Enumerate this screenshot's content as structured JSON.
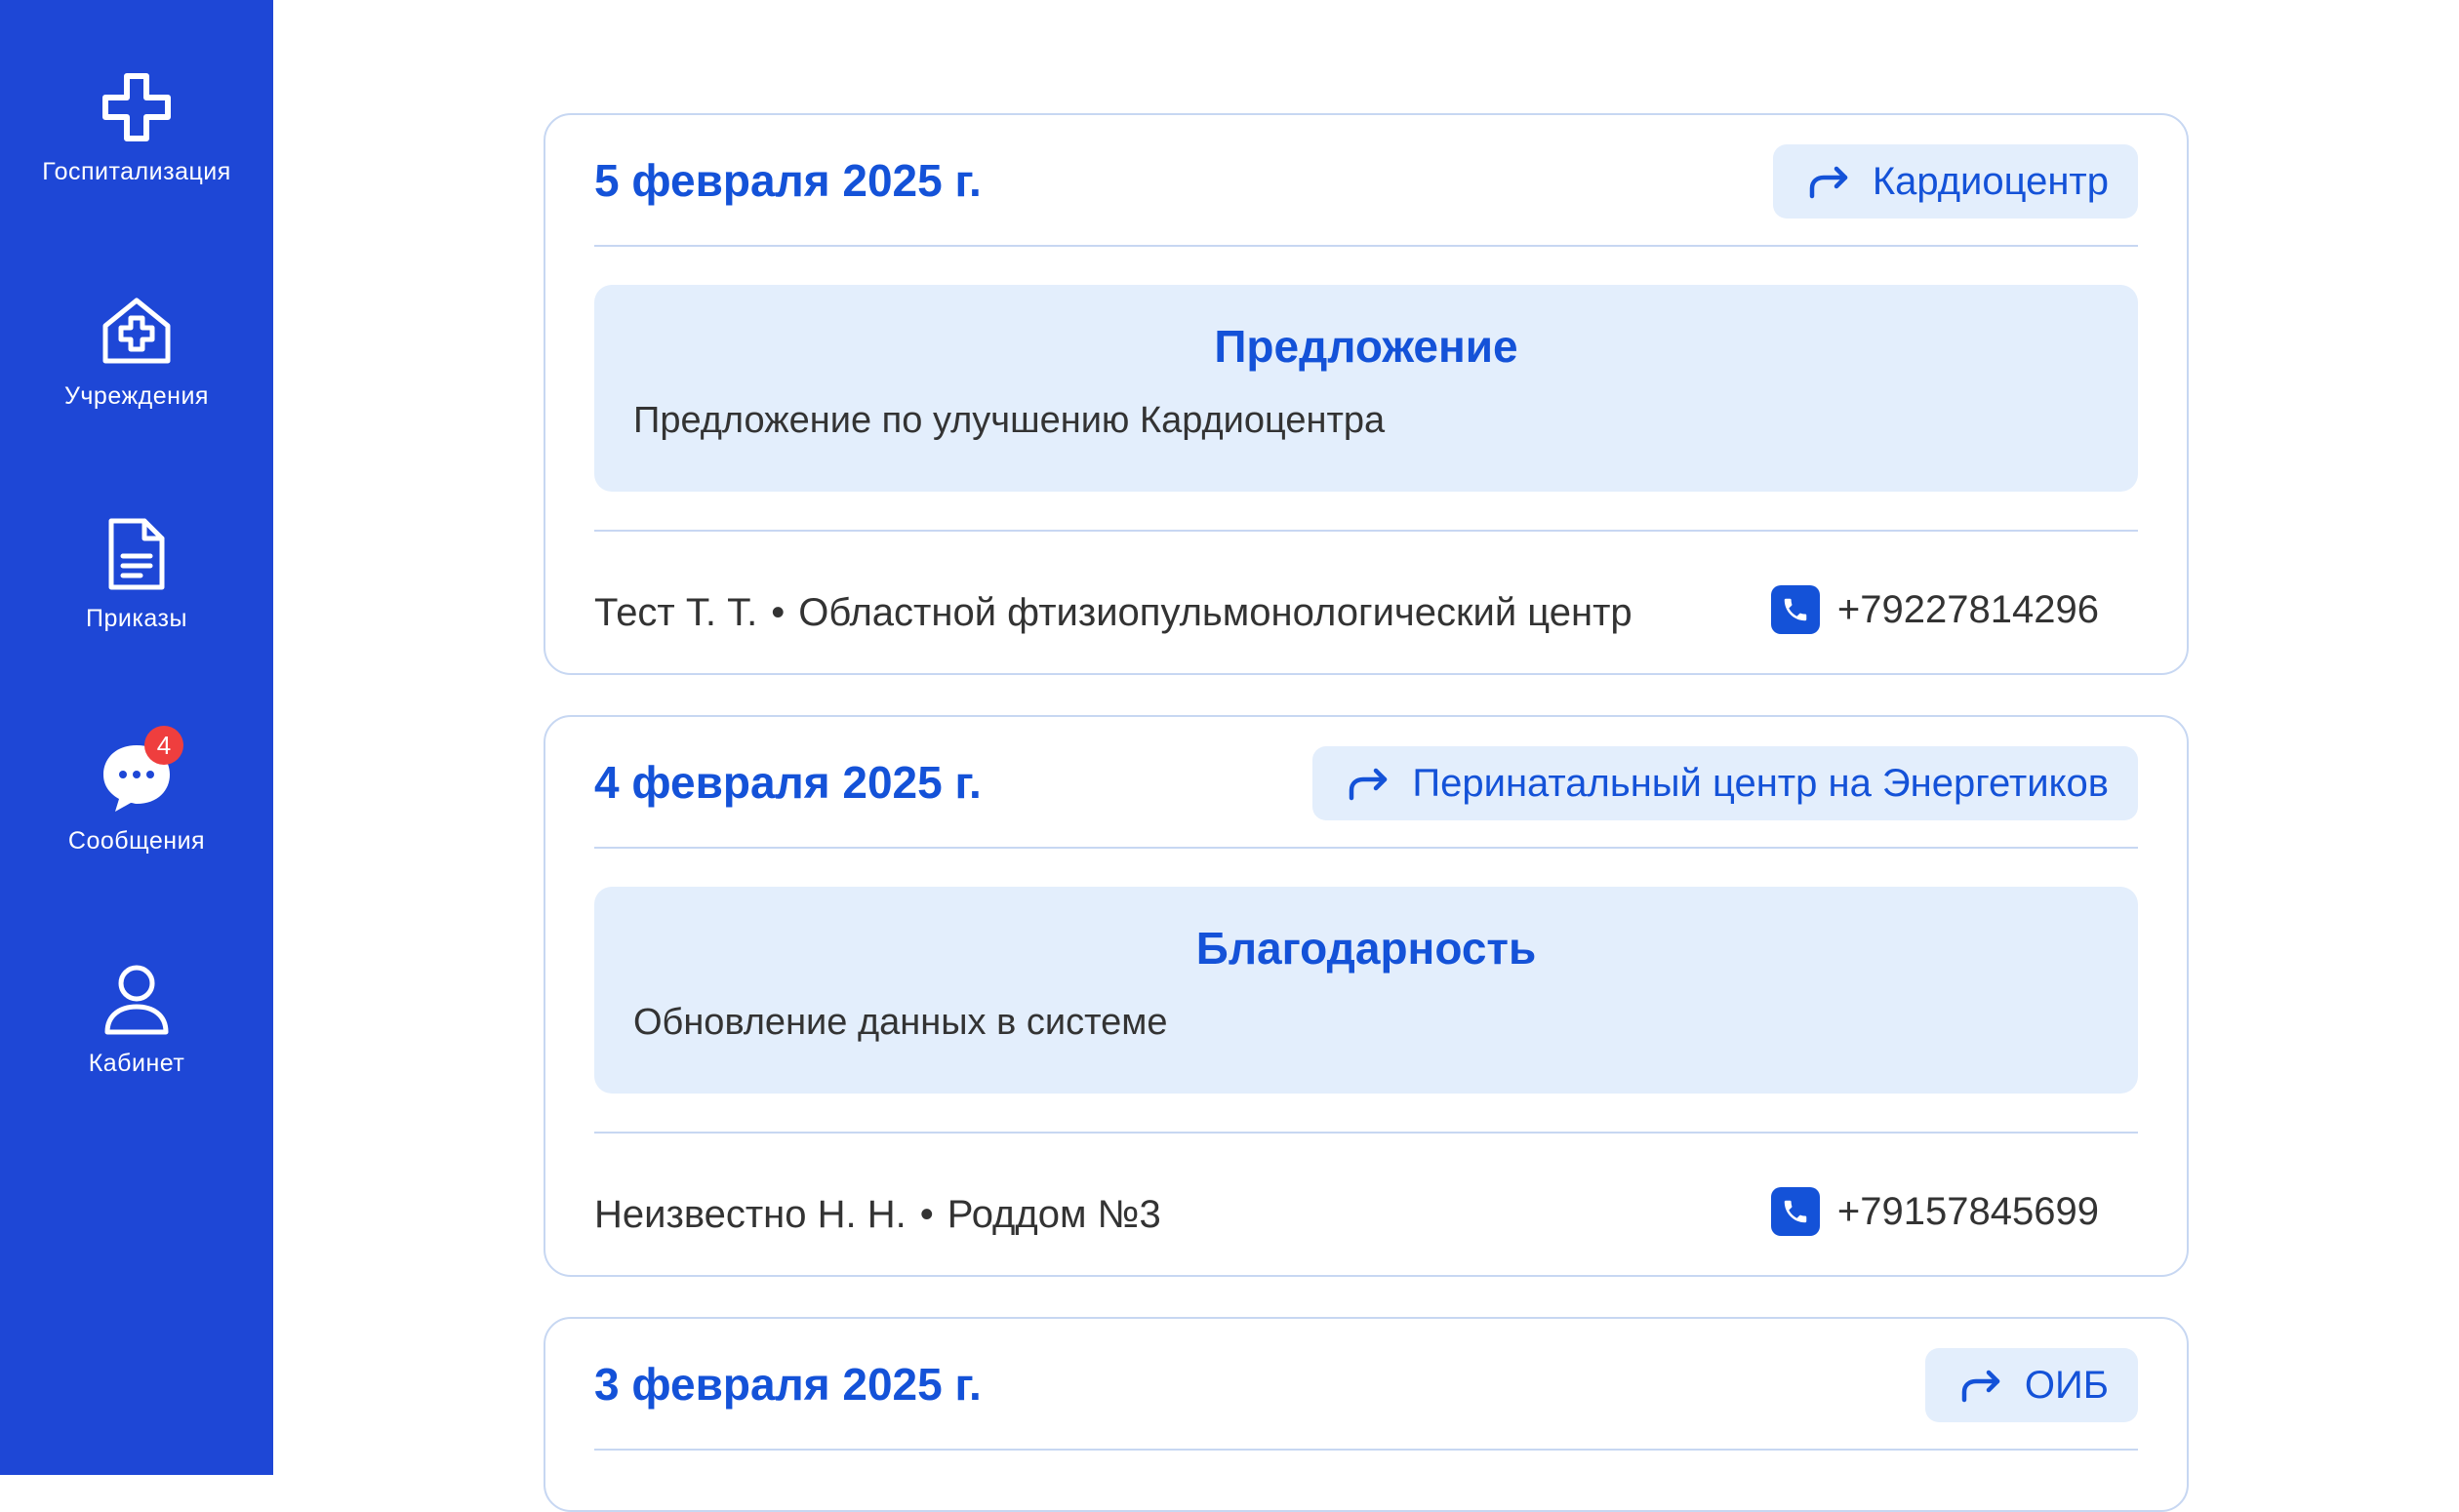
{
  "sidebar": {
    "items": [
      {
        "label": "Госпитализация",
        "icon": "medical-cross-icon"
      },
      {
        "label": "Учреждения",
        "icon": "hospital-house-icon"
      },
      {
        "label": "Приказы",
        "icon": "document-icon"
      },
      {
        "label": "Сообщения",
        "icon": "chat-bubble-icon",
        "badge": "4"
      },
      {
        "label": "Кабинет",
        "icon": "user-icon"
      }
    ]
  },
  "colors": {
    "sidebar_bg": "#1e47d6",
    "accent": "#1452d8",
    "chip_bg": "#e3eefc",
    "border": "#c7d7f2",
    "badge": "#ef3e3e"
  },
  "messages": [
    {
      "date": "5 февраля 2025 г.",
      "destination": "Кардиоцентр",
      "type": "Предложение",
      "text": "Предложение по улучшению Кардиоцентра",
      "sender_name": "Тест Т. Т.",
      "sender_org": "Областной фтизиопульмонологический центр",
      "phone": "+79227814296"
    },
    {
      "date": "4 февраля 2025 г.",
      "destination": "Перинатальный центр на Энергетиков",
      "type": "Благодарность",
      "text": "Обновление данных в системе",
      "sender_name": "Неизвестно Н. Н.",
      "sender_org": "Роддом №3",
      "phone": "+79157845699"
    },
    {
      "date": "3 февраля 2025 г.",
      "destination": "ОИБ"
    }
  ]
}
